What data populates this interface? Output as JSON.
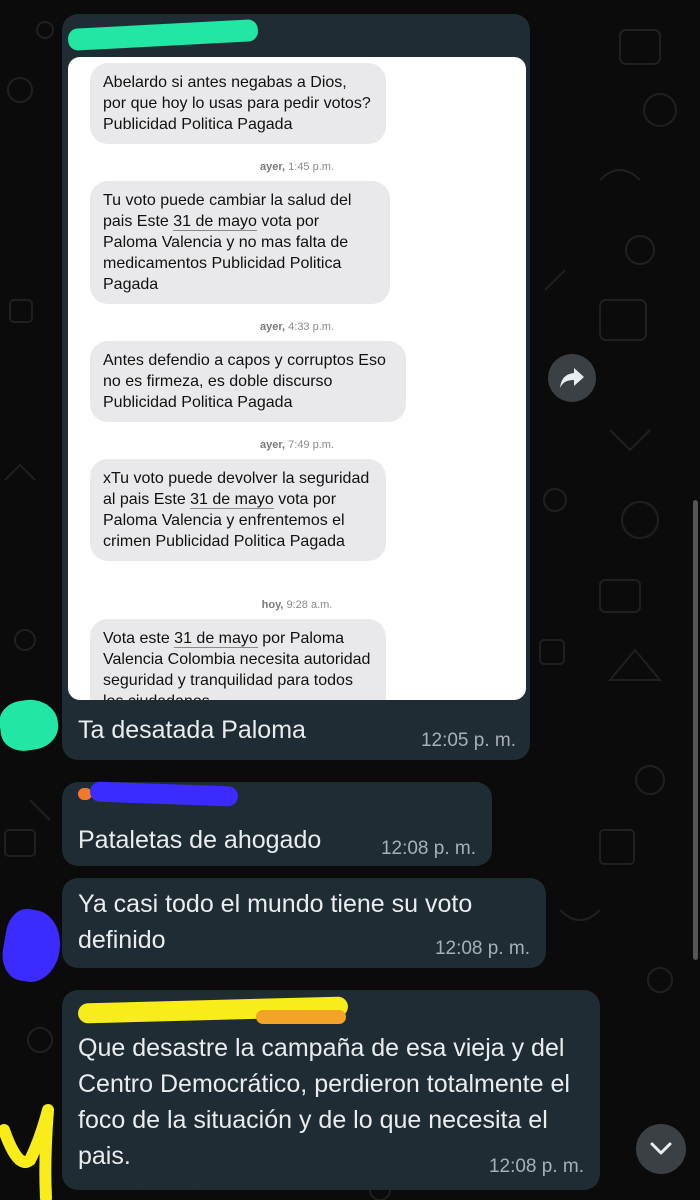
{
  "embedded_screenshot": {
    "messages": [
      {
        "text": "Abelardo si antes negabas a Dios, por que hoy lo usas para pedir votos? Publicidad Politica Pagada"
      },
      {
        "timestamp_day": "ayer,",
        "timestamp_time": "1:45 p.m."
      },
      {
        "text_before": "Tu voto puede cambiar la salud del pais Este ",
        "link": "31 de mayo",
        "text_after": " vota por Paloma Valencia y no mas falta de medicamentos Publicidad Politica Pagada"
      },
      {
        "timestamp_day": "ayer,",
        "timestamp_time": "4:33 p.m."
      },
      {
        "text": "Antes defendio a capos y corruptos Eso no es firmeza, es doble discurso Publicidad Politica Pagada"
      },
      {
        "timestamp_day": "ayer,",
        "timestamp_time": "7:49 p.m."
      },
      {
        "text_before": "xTu voto puede devolver la seguridad al pais Este ",
        "link": "31 de mayo",
        "text_after": " vota por Paloma Valencia y enfrentemos el crimen Publicidad Politica Pagada"
      },
      {
        "timestamp_day": "hoy,",
        "timestamp_time": "9:28 a.m."
      },
      {
        "text_before": "Vota este ",
        "link": "31 de mayo",
        "text_after": " por Paloma Valencia Colombia necesita autoridad seguridad y tranquilidad para todos los ciudadanos"
      }
    ]
  },
  "chat": [
    {
      "text": "Ta desatada Paloma",
      "time": "12:05 p. m."
    },
    {
      "text": "Pataletas de ahogado",
      "time": "12:08 p. m."
    },
    {
      "text": "Ya casi todo el mundo tiene su voto definido",
      "time": "12:08 p. m."
    },
    {
      "text": "Que desastre la campaña de esa vieja y del Centro Democrático, perdieron totalmente el foco de la situación y de lo que necesita el pais.",
      "time": "12:08 p. m."
    }
  ],
  "icons": {
    "forward": "share-forward-icon",
    "scroll": "chevron-down-icon"
  },
  "colors": {
    "bubble": "#202c33",
    "mask_green": "#22e6a3",
    "mask_blue": "#3b2bff",
    "mask_yellow": "#f8ec1a",
    "mask_orange": "#f07a2a"
  }
}
